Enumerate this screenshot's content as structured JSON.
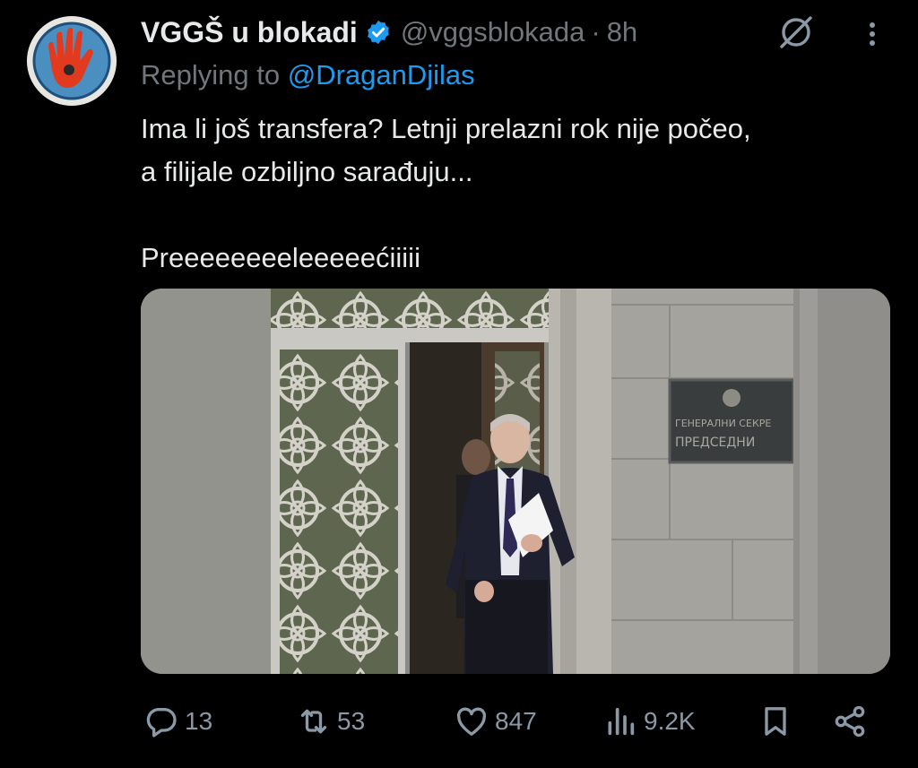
{
  "tweet": {
    "display_name": "VGGŠ u blokadi",
    "handle": "@vggsblokada",
    "separator": "·",
    "time": "8h",
    "replying_prefix": "Replying to",
    "replying_to": "@DraganDjilas",
    "text_line1": "Ima li još transfera? Letnji prelazni rok nije počeo,",
    "text_line2": "a filijale ozbiljno sarađuju...",
    "text_line3": "Preeeeeeeeleeeeećiiiii"
  },
  "media": {
    "description_icon": "photo",
    "plaque_line1": "ГЕНЕРАЛНИ СЕКРЕ",
    "plaque_line2": "ПРЕДСЕДНИ"
  },
  "actions": {
    "replies": "13",
    "reposts": "53",
    "likes": "847",
    "views": "9.2K"
  },
  "icons": {
    "verified": "verified-badge-icon",
    "grok": "grok-icon",
    "more": "more-vertical-icon",
    "reply": "reply-icon",
    "repost": "repost-icon",
    "like": "heart-icon",
    "views": "views-icon",
    "bookmark": "bookmark-icon",
    "share": "share-icon"
  },
  "colors": {
    "background": "#000000",
    "text": "#e7e9ea",
    "secondary": "#71767b",
    "accent": "#1d9bf0",
    "action": "#8b98a5"
  }
}
